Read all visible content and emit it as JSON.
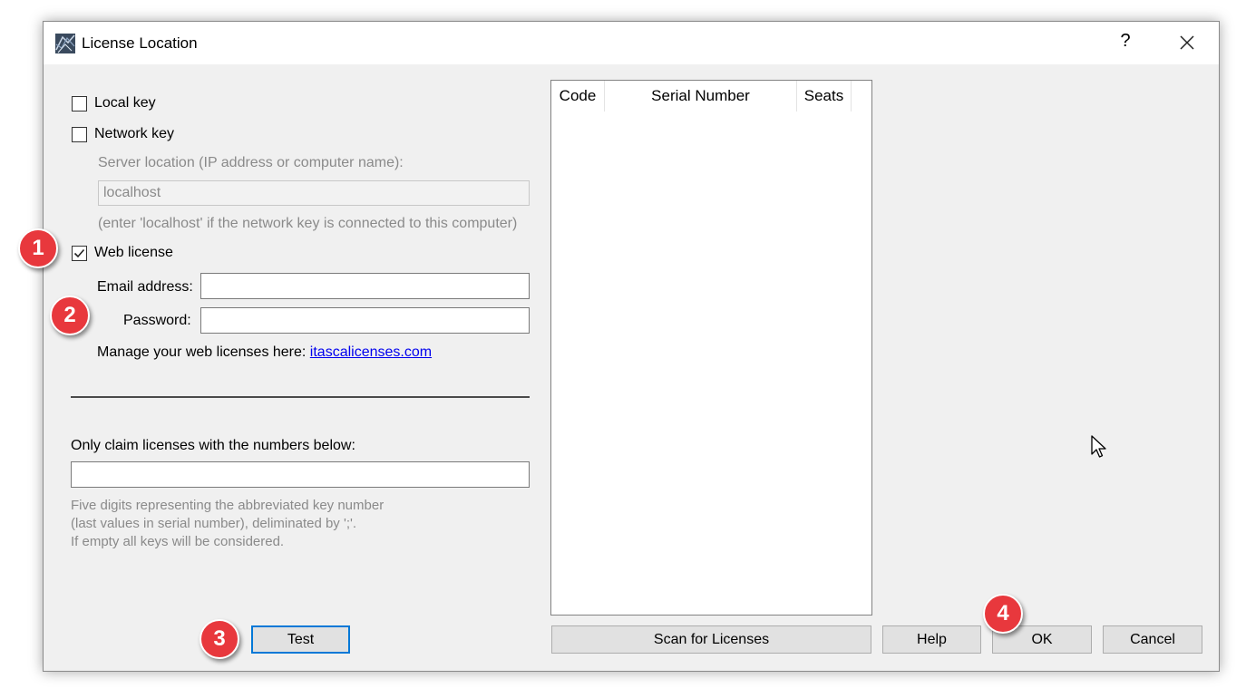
{
  "window": {
    "title": "License Location",
    "help_glyph": "?",
    "close_glyph": "×"
  },
  "local_key": {
    "label": "Local key",
    "checked": false
  },
  "network_key": {
    "label": "Network key",
    "checked": false,
    "server_label": "Server location (IP address or computer name):",
    "server_value": "localhost",
    "hint": "(enter 'localhost' if the network key is connected to this computer)"
  },
  "web_license": {
    "label": "Web license",
    "checked": true,
    "email_label": "Email address:",
    "email_value": "",
    "password_label": "Password:",
    "password_value": "",
    "manage_text": "Manage your web licenses here: ",
    "manage_link": "itascalicenses.com"
  },
  "claim": {
    "label": "Only claim licenses with the numbers below:",
    "value": "",
    "help_line1": "Five digits representing the abbreviated key number",
    "help_line2": "(last values in serial number), deliminated by ';'.",
    "help_line3": "If empty all keys will be considered."
  },
  "table": {
    "columns": [
      "Code",
      "Serial Number",
      "Seats"
    ],
    "rows": []
  },
  "buttons": {
    "test": "Test",
    "scan": "Scan for Licenses",
    "help": "Help",
    "ok": "OK",
    "cancel": "Cancel"
  },
  "badges": [
    "1",
    "2",
    "3",
    "4"
  ],
  "colors": {
    "badge": "#e8383d",
    "link": "#0000ee",
    "focus": "#0078d7"
  },
  "icons": {
    "app": "app-logo-icon",
    "close": "close-icon",
    "check": "checkmark-icon",
    "cursor": "mouse-cursor-icon"
  }
}
